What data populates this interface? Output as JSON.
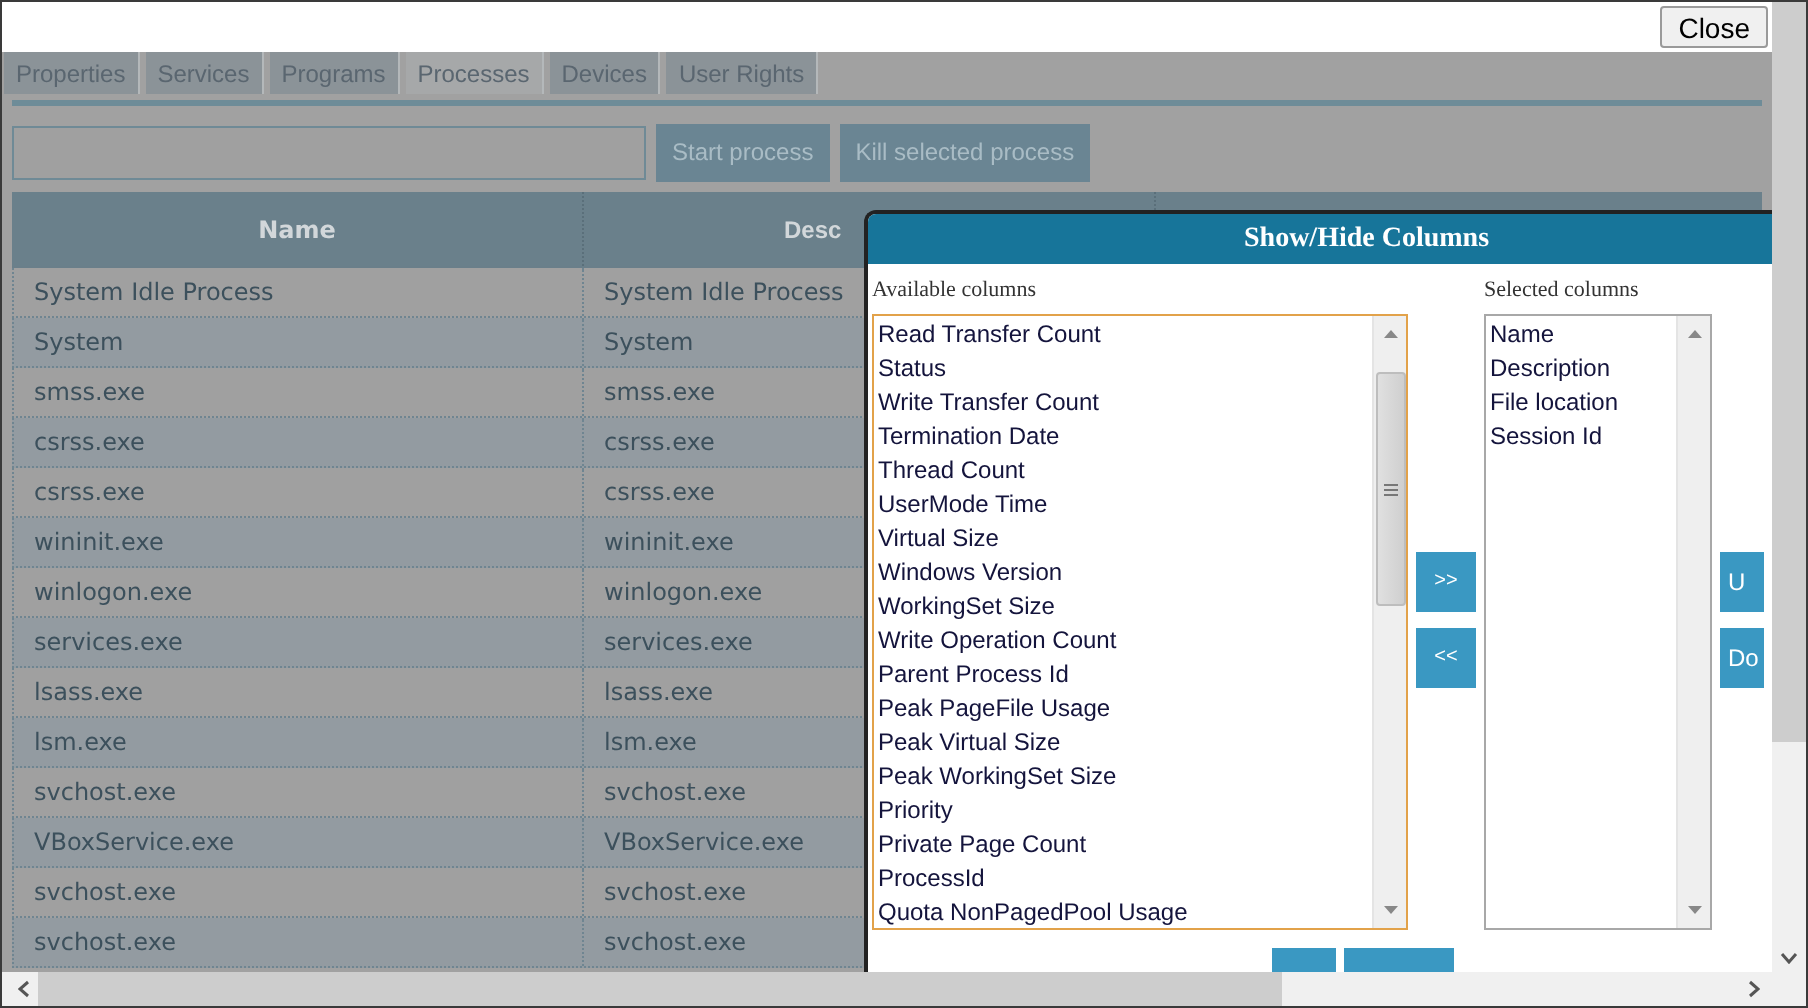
{
  "close_button": "Close",
  "tabs": [
    {
      "label": "Properties",
      "selected": false
    },
    {
      "label": "Services",
      "selected": false
    },
    {
      "label": "Programs",
      "selected": false
    },
    {
      "label": "Processes",
      "selected": true
    },
    {
      "label": "Devices",
      "selected": false
    },
    {
      "label": "User Rights",
      "selected": false
    }
  ],
  "toolbar": {
    "buttons": [
      "Start process",
      "Kill selected process"
    ]
  },
  "table": {
    "columns": [
      "Name",
      "Desc"
    ],
    "rows": [
      {
        "name": "System Idle Process",
        "description": "System Idle Process"
      },
      {
        "name": "System",
        "description": "System"
      },
      {
        "name": "smss.exe",
        "description": "smss.exe"
      },
      {
        "name": "csrss.exe",
        "description": "csrss.exe"
      },
      {
        "name": "csrss.exe",
        "description": "csrss.exe"
      },
      {
        "name": "wininit.exe",
        "description": "wininit.exe"
      },
      {
        "name": "winlogon.exe",
        "description": "winlogon.exe"
      },
      {
        "name": "services.exe",
        "description": "services.exe"
      },
      {
        "name": "lsass.exe",
        "description": "lsass.exe"
      },
      {
        "name": "lsm.exe",
        "description": "lsm.exe"
      },
      {
        "name": "svchost.exe",
        "description": "svchost.exe"
      },
      {
        "name": "VBoxService.exe",
        "description": "VBoxService.exe"
      },
      {
        "name": "svchost.exe",
        "description": "svchost.exe"
      },
      {
        "name": "svchost.exe",
        "description": "svchost.exe"
      }
    ]
  },
  "dialog": {
    "title": "Show/Hide Columns",
    "available_label": "Available columns",
    "available_columns": [
      "Read Transfer Count",
      "Status",
      "Write Transfer Count",
      "Termination Date",
      "Thread Count",
      "UserMode Time",
      "Virtual Size",
      "Windows Version",
      "WorkingSet Size",
      "Write Operation Count",
      "Parent Process Id",
      "Peak PageFile Usage",
      "Peak Virtual Size",
      "Peak WorkingSet Size",
      "Priority",
      "Private Page Count",
      "ProcessId",
      "Quota NonPagedPool Usage"
    ],
    "selected_label": "Selected columns",
    "selected_columns": [
      "Name",
      "Description",
      "File location",
      "Session Id"
    ],
    "move_buttons": [
      ">>",
      "<<"
    ],
    "order_buttons": [
      "U",
      "Do"
    ]
  }
}
